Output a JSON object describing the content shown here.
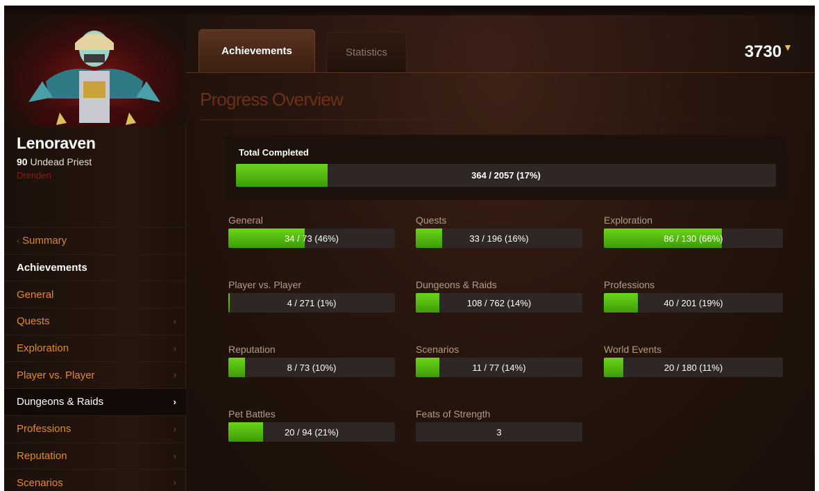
{
  "character": {
    "name": "Lenoraven",
    "level": "90",
    "race_class": "Undead Priest",
    "realm": "Drenden"
  },
  "sidebar": {
    "items": [
      {
        "label": "Summary",
        "type": "back"
      },
      {
        "label": "Achievements",
        "type": "header"
      },
      {
        "label": "General",
        "type": "link",
        "chevron": false
      },
      {
        "label": "Quests",
        "type": "link",
        "chevron": true
      },
      {
        "label": "Exploration",
        "type": "link",
        "chevron": true
      },
      {
        "label": "Player vs. Player",
        "type": "link",
        "chevron": true
      },
      {
        "label": "Dungeons & Raids",
        "type": "active",
        "chevron": true
      },
      {
        "label": "Professions",
        "type": "link",
        "chevron": true
      },
      {
        "label": "Reputation",
        "type": "link",
        "chevron": true
      },
      {
        "label": "Scenarios",
        "type": "link",
        "chevron": true
      }
    ]
  },
  "tabs": [
    {
      "label": "Achievements",
      "active": true
    },
    {
      "label": "Statistics",
      "active": false
    }
  ],
  "points": "3730",
  "section_title": "Progress Overview",
  "total": {
    "label": "Total Completed",
    "text": "364 / 2057 (17%)",
    "progress": 0.17
  },
  "categories": [
    {
      "label": "General",
      "text": "34 / 73 (46%)",
      "progress": 0.46
    },
    {
      "label": "Quests",
      "text": "33 / 196 (16%)",
      "progress": 0.16
    },
    {
      "label": "Exploration",
      "text": "86 / 130 (66%)",
      "progress": 0.66
    },
    {
      "label": "Player vs. Player",
      "text": "4 / 271 (1%)",
      "progress": 0.01
    },
    {
      "label": "Dungeons & Raids",
      "text": "108 / 762 (14%)",
      "progress": 0.14
    },
    {
      "label": "Professions",
      "text": "40 / 201 (19%)",
      "progress": 0.19
    },
    {
      "label": "Reputation",
      "text": "8 / 73 (10%)",
      "progress": 0.1
    },
    {
      "label": "Scenarios",
      "text": "11 / 77 (14%)",
      "progress": 0.14
    },
    {
      "label": "World Events",
      "text": "20 / 180 (11%)",
      "progress": 0.11
    },
    {
      "label": "Pet Battles",
      "text": "20 / 94 (21%)",
      "progress": 0.21
    },
    {
      "label": "Feats of Strength",
      "text": "3",
      "progress": 0
    }
  ],
  "colors": {
    "accent_orange": "#e48a1f",
    "progress_green": "#5cc414",
    "realm_red": "#8b1d12"
  }
}
